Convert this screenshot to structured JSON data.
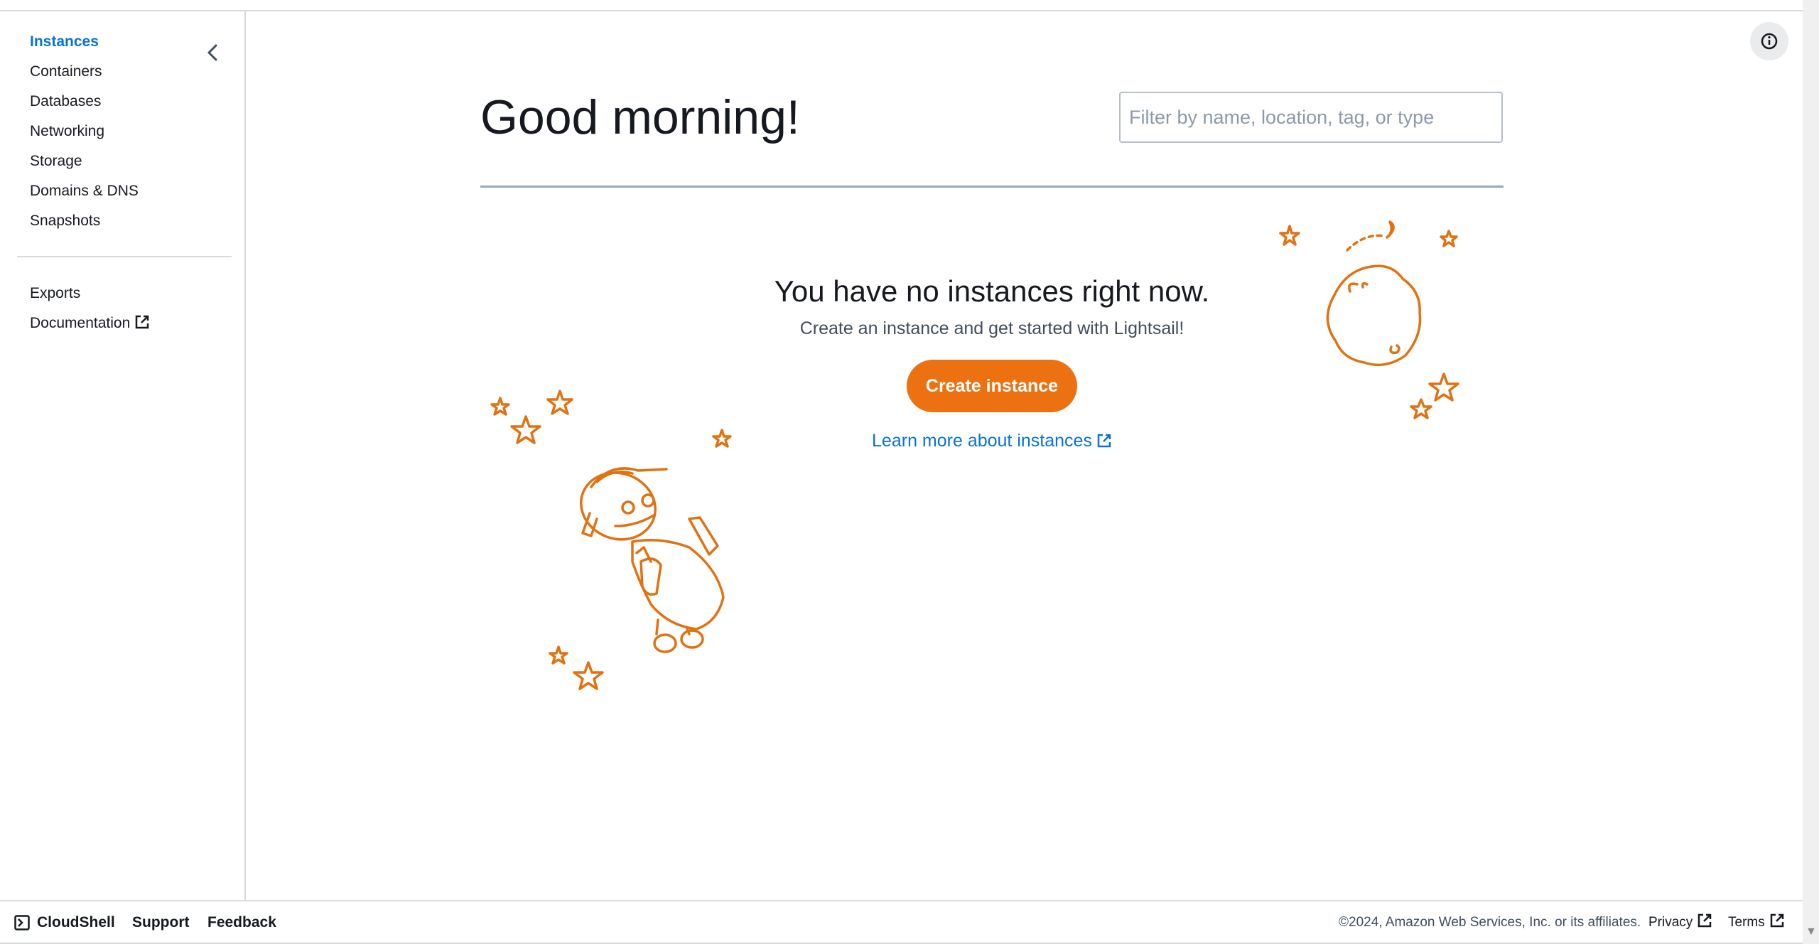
{
  "sidebar": {
    "items": [
      {
        "label": "Instances",
        "active": true
      },
      {
        "label": "Containers"
      },
      {
        "label": "Databases"
      },
      {
        "label": "Networking"
      },
      {
        "label": "Storage"
      },
      {
        "label": "Domains & DNS"
      },
      {
        "label": "Snapshots"
      }
    ],
    "secondary": [
      {
        "label": "Exports"
      },
      {
        "label": "Documentation",
        "external": true
      }
    ]
  },
  "main": {
    "greeting": "Good morning!",
    "filter_placeholder": "Filter by name, location, tag, or type",
    "empty_title": "You have no instances right now.",
    "empty_subtitle": "Create an instance and get started with Lightsail!",
    "create_button": "Create instance",
    "learn_link": "Learn more about instances"
  },
  "footer": {
    "cloudshell": "CloudShell",
    "support": "Support",
    "feedback": "Feedback",
    "copyright": "©2024, Amazon Web Services, Inc. or its affiliates.",
    "privacy": "Privacy",
    "terms": "Terms"
  },
  "colors": {
    "accent": "#ec7211",
    "link": "#0972d3",
    "text": "#16191f"
  },
  "icons": [
    "chevron-left-icon",
    "external-link-icon",
    "info-icon",
    "cloudshell-icon"
  ]
}
